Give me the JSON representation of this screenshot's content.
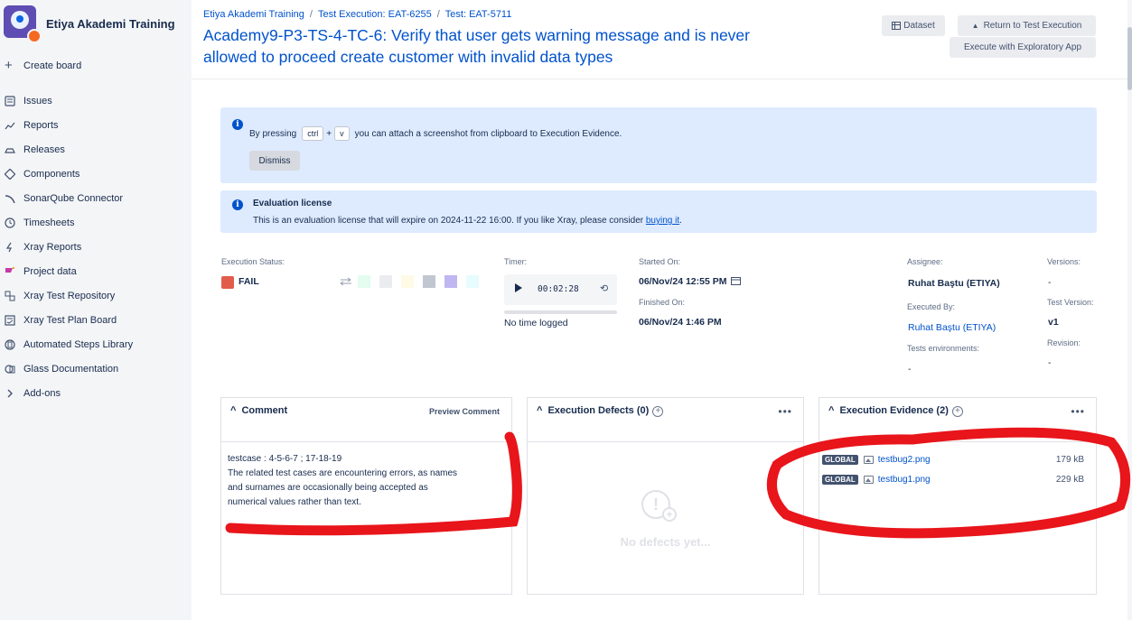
{
  "sidebar": {
    "project_name": "Etiya Akademi Training",
    "create_board": "Create board",
    "items": [
      {
        "label": "Issues",
        "icon": "issues-icon"
      },
      {
        "label": "Reports",
        "icon": "reports-icon"
      },
      {
        "label": "Releases",
        "icon": "releases-icon"
      },
      {
        "label": "Components",
        "icon": "components-icon"
      },
      {
        "label": "SonarQube Connector",
        "icon": "sonarqube-icon"
      },
      {
        "label": "Timesheets",
        "icon": "clock-icon"
      },
      {
        "label": "Xray Reports",
        "icon": "xray-icon"
      },
      {
        "label": "Project data",
        "icon": "project-data-icon"
      },
      {
        "label": "Xray Test Repository",
        "icon": "repository-icon"
      },
      {
        "label": "Xray Test Plan Board",
        "icon": "plan-board-icon"
      },
      {
        "label": "Automated Steps Library",
        "icon": "library-icon"
      },
      {
        "label": "Glass Documentation",
        "icon": "glass-icon"
      },
      {
        "label": "Add-ons",
        "icon": "chevron-right-icon"
      }
    ]
  },
  "header": {
    "breadcrumb": [
      "Etiya Akademi Training",
      "Test Execution: EAT-6255",
      "Test: EAT-5711"
    ],
    "title_line1": "Academy9-P3-TS-4-TC-6: Verify that user gets warning message and is never",
    "title_line2": "allowed to proceed create customer with invalid data types",
    "dataset_label": "Dataset",
    "return_label": "Return to Test Execution",
    "exploratory_label": "Execute with Exploratory App"
  },
  "clipboard_banner": {
    "prefix": "By pressing",
    "key1": "ctrl",
    "plus": "+",
    "key2": "v",
    "suffix": "you can attach a screenshot from clipboard to Execution Evidence.",
    "dismiss": "Dismiss"
  },
  "license_banner": {
    "title": "Evaluation license",
    "text": "This is an evaluation license that will expire on 2024-11-22 16:00. If you like Xray, please consider ",
    "link": "buying it",
    "end": "."
  },
  "execution": {
    "status_label": "Execution Status:",
    "status_value": "FAIL",
    "status_color": "#e25c4b",
    "swatches": [
      "#e3fcef",
      "#ebecf0",
      "#fffae6",
      "#c1c7d0",
      "#c0b6f2",
      "#e6fcff"
    ],
    "timer_label": "Timer:",
    "timer_value": "00:02:28",
    "time_logged": "No time logged",
    "started_label": "Started On:",
    "started_value": "06/Nov/24 12:55 PM",
    "finished_label": "Finished On:",
    "finished_value": "06/Nov/24 1:46 PM",
    "assignee_label": "Assignee:",
    "assignee_value": "Ruhat Baştu (ETIYA)",
    "executed_by_label": "Executed By:",
    "executed_by_value": "Ruhat Baştu (ETIYA)",
    "tests_env_label": "Tests environments:",
    "tests_env_value": "-",
    "versions_label": "Versions:",
    "versions_value": "-",
    "test_version_label": "Test Version:",
    "test_version_value": "v1",
    "revision_label": "Revision:",
    "revision_value": "-"
  },
  "comment_panel": {
    "title": "Comment",
    "preview": "Preview Comment",
    "line1": "testcase : 4-5-6-7 ;  17-18-19",
    "line2": "The related test cases are encountering errors, as names",
    "line3": "and surnames are occasionally being accepted as",
    "line4": "numerical values rather than text."
  },
  "defects_panel": {
    "title": "Execution Defects (0)",
    "empty": "No defects yet..."
  },
  "evidence_panel": {
    "title": "Execution Evidence (2)",
    "files": [
      {
        "tag": "GLOBAL",
        "name": "testbug2.png",
        "size": "179 kB"
      },
      {
        "tag": "GLOBAL",
        "name": "testbug1.png",
        "size": "229 kB"
      }
    ]
  }
}
